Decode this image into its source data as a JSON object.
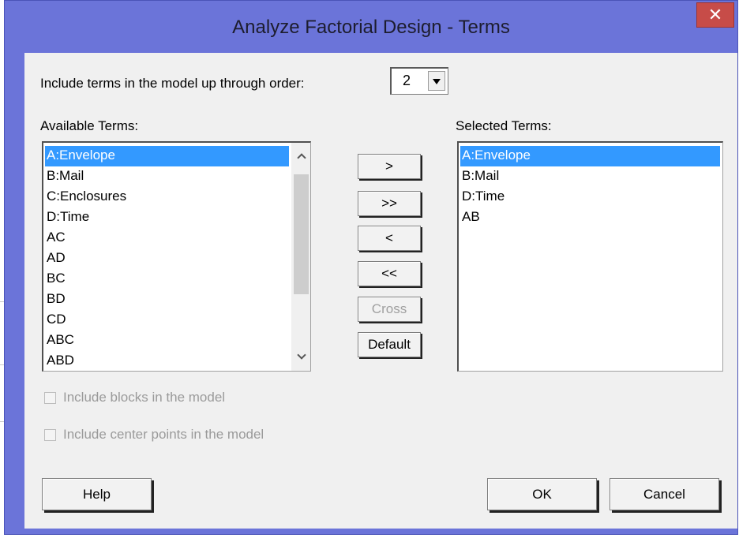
{
  "window": {
    "title": "Analyze Factorial Design - Terms",
    "close_glyph": "✕"
  },
  "order": {
    "label": "Include terms in the model up through order:",
    "value": "2"
  },
  "available": {
    "label": "Available Terms:",
    "items": [
      "A:Envelope",
      "B:Mail",
      "C:Enclosures",
      "D:Time",
      "AC",
      "AD",
      "BC",
      "BD",
      "CD",
      "ABC",
      "ABD"
    ],
    "selected_index": 0
  },
  "selected": {
    "label": "Selected Terms:",
    "items": [
      "A:Envelope",
      "B:Mail",
      "D:Time",
      "AB"
    ],
    "selected_index": 0
  },
  "transfer_buttons": {
    "add": ">",
    "add_all": ">>",
    "remove": "<",
    "remove_all": "<<",
    "cross": "Cross",
    "default": "Default"
  },
  "options": {
    "blocks_label": "Include blocks in the model",
    "center_points_label": "Include center points in the model"
  },
  "footer": {
    "help": "Help",
    "ok": "OK",
    "cancel": "Cancel"
  },
  "colors": {
    "frame": "#6b74d9",
    "selection": "#3399ff",
    "close": "#c74c48"
  }
}
